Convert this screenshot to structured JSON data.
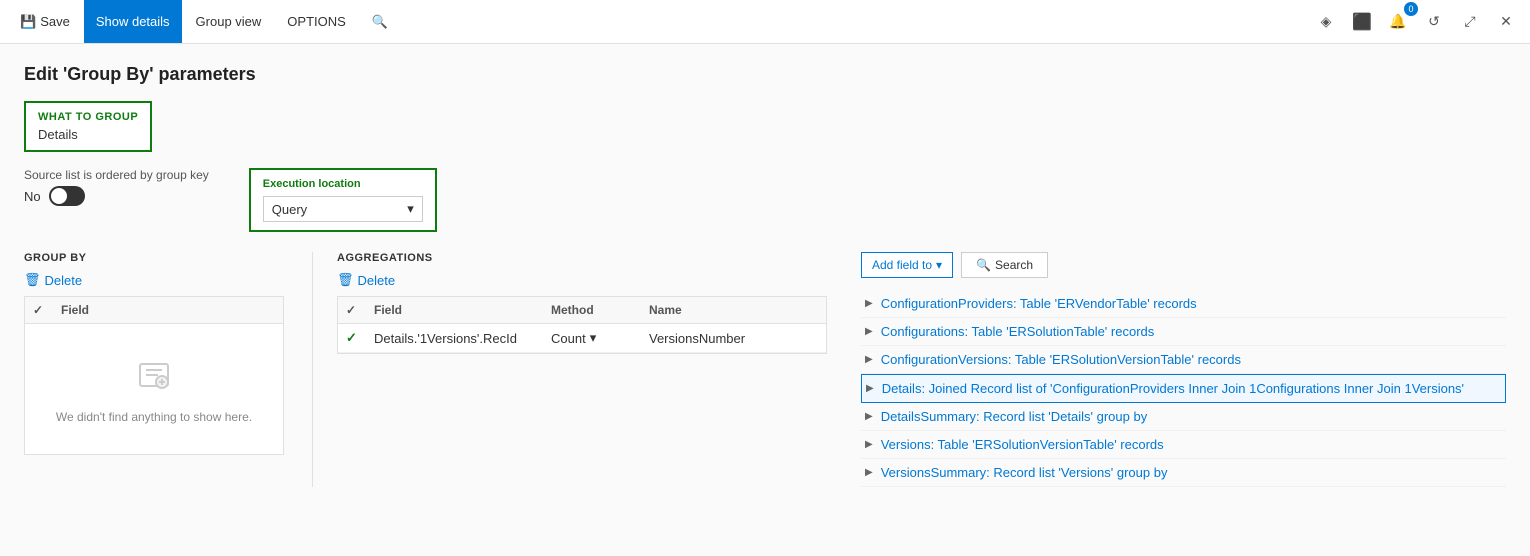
{
  "titleBar": {
    "saveLabel": "Save",
    "showDetailsLabel": "Show details",
    "groupViewLabel": "Group view",
    "optionsLabel": "OPTIONS",
    "notificationCount": "0",
    "icons": {
      "settings": "⚙",
      "office": "⬛",
      "refresh": "↺",
      "popout": "⤢",
      "close": "✕",
      "search": "🔍",
      "diamond": "◈"
    }
  },
  "page": {
    "title": "Edit 'Group By' parameters",
    "whatToGroup": {
      "label": "What to group",
      "value": "Details"
    },
    "sourceListLabel": "Source list is ordered by group key",
    "toggleLabel": "No",
    "executionLocation": {
      "label": "Execution location",
      "value": "Query"
    },
    "groupBy": {
      "sectionLabel": "GROUP BY",
      "deleteLabel": "Delete",
      "columns": [
        {
          "key": "check",
          "label": ""
        },
        {
          "key": "field",
          "label": "Field"
        }
      ],
      "emptyIcon": "🗑",
      "emptyText": "We didn't find anything to show here."
    },
    "aggregations": {
      "sectionLabel": "AGGREGATIONS",
      "deleteLabel": "Delete",
      "columns": [
        {
          "key": "check",
          "label": ""
        },
        {
          "key": "field",
          "label": "Field"
        },
        {
          "key": "method",
          "label": "Method"
        },
        {
          "key": "name",
          "label": "Name"
        }
      ],
      "rows": [
        {
          "check": true,
          "field": "Details.'1Versions'.RecId",
          "method": "Count",
          "name": "VersionsNumber"
        }
      ]
    },
    "fieldList": {
      "addFieldLabel": "Add field to",
      "searchLabel": "Search",
      "items": [
        {
          "id": 1,
          "text": "ConfigurationProviders: Table 'ERVendorTable' records",
          "highlighted": false
        },
        {
          "id": 2,
          "text": "Configurations: Table 'ERSolutionTable' records",
          "highlighted": false
        },
        {
          "id": 3,
          "text": "ConfigurationVersions: Table 'ERSolutionVersionTable' records",
          "highlighted": false
        },
        {
          "id": 4,
          "text": "Details: Joined Record list of 'ConfigurationProviders Inner Join 1Configurations Inner Join 1Versions'",
          "highlighted": true
        },
        {
          "id": 5,
          "text": "DetailsSummary: Record list 'Details' group by",
          "highlighted": false
        },
        {
          "id": 6,
          "text": "Versions: Table 'ERSolutionVersionTable' records",
          "highlighted": false
        },
        {
          "id": 7,
          "text": "VersionsSummary: Record list 'Versions' group by",
          "highlighted": false
        }
      ]
    }
  }
}
